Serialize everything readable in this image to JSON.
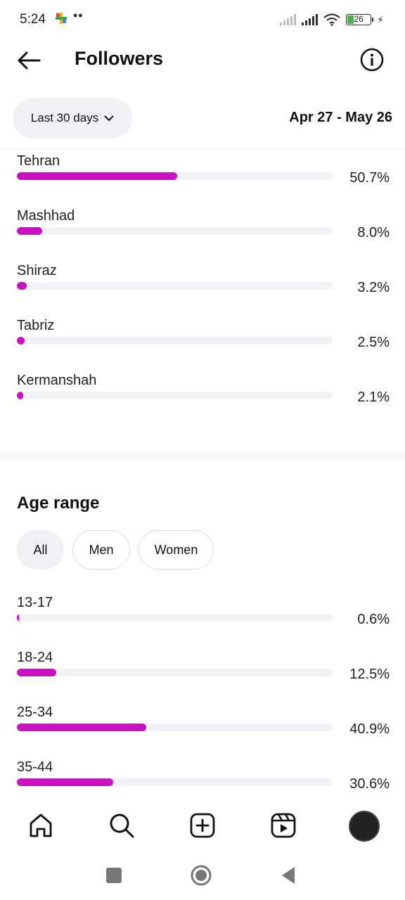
{
  "status_bar": {
    "time": "5:24",
    "dots": "••",
    "battery_level": "26"
  },
  "header": {
    "title": "Followers"
  },
  "filter": {
    "range_label": "Last 30 days",
    "date_range": "Apr 27 - May 26"
  },
  "cities": [
    {
      "name": "Tehran",
      "percent_label": "50.7%",
      "value": 50.7
    },
    {
      "name": "Mashhad",
      "percent_label": "8.0%",
      "value": 8.0
    },
    {
      "name": "Shiraz",
      "percent_label": "3.2%",
      "value": 3.2
    },
    {
      "name": "Tabriz",
      "percent_label": "2.5%",
      "value": 2.5
    },
    {
      "name": "Kermanshah",
      "percent_label": "2.1%",
      "value": 2.1
    }
  ],
  "age_range": {
    "title": "Age range",
    "tabs": [
      {
        "label": "All",
        "active": true
      },
      {
        "label": "Men",
        "active": false
      },
      {
        "label": "Women",
        "active": false
      }
    ],
    "items": [
      {
        "name": "13-17",
        "percent_label": "0.6%",
        "value": 0.6
      },
      {
        "name": "18-24",
        "percent_label": "12.5%",
        "value": 12.5
      },
      {
        "name": "25-34",
        "percent_label": "40.9%",
        "value": 40.9
      },
      {
        "name": "35-44",
        "percent_label": "30.6%",
        "value": 30.6
      }
    ]
  },
  "colors": {
    "bar": "#cc0fc4",
    "track": "#f1f2f5"
  },
  "bottom_nav": [
    "home-icon",
    "search-icon",
    "create-icon",
    "reels-icon",
    "profile-avatar"
  ]
}
